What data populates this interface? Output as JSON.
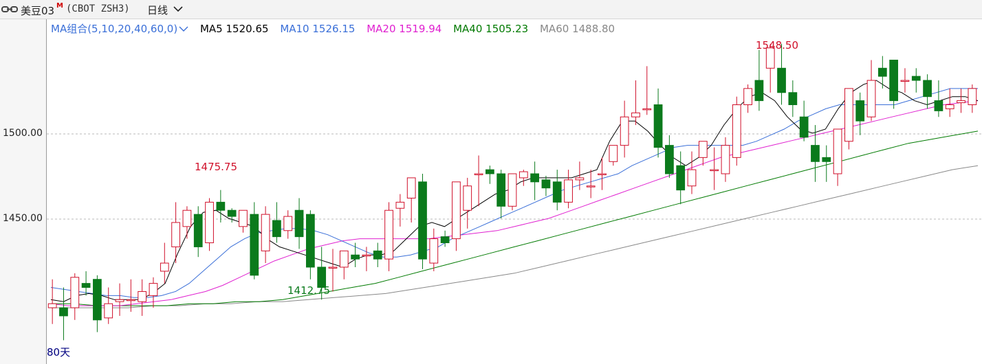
{
  "title": {
    "name": "美豆03",
    "superscript": "M",
    "code": "(CBOT ZSH3)",
    "period": "日线"
  },
  "ma_legend": {
    "selector": "MA组合(5,10,20,40,60,0)",
    "items": [
      {
        "label": "MA5",
        "value": "1520.65",
        "color": "#000000"
      },
      {
        "label": "MA10",
        "value": "1526.15",
        "color": "#3a6fd8"
      },
      {
        "label": "MA20",
        "value": "1519.94",
        "color": "#e020d0"
      },
      {
        "label": "MA40",
        "value": "1505.23",
        "color": "#007a00"
      },
      {
        "label": "MA60",
        "value": "1488.80",
        "color": "#888888"
      }
    ]
  },
  "y_axis": {
    "ticks": [
      {
        "value": 1500,
        "label": "1500.00"
      },
      {
        "value": 1450,
        "label": "1450.00"
      }
    ]
  },
  "annotations": {
    "high_label": "1548.50",
    "high_value": 1548.5,
    "low_label": "1412.75",
    "low_value": 1412.75,
    "peak_label": "1475.75",
    "peak_value": 1475.75
  },
  "days_label": "80天",
  "colors": {
    "up": "#d0102a",
    "down": "#0b7a1c",
    "ma5": "#000000",
    "ma10": "#3a6fd8",
    "ma20": "#e020d0",
    "ma40": "#007a00",
    "ma60": "#888888"
  },
  "chart_data": {
    "type": "candlestick",
    "y_range": [
      1393,
      1552
    ],
    "candles": [
      [
        1418,
        1432,
        1420,
        1410
      ],
      [
        1418,
        1428,
        1414,
        1402
      ],
      [
        1418,
        1435,
        1433,
        1412
      ],
      [
        1430,
        1436,
        1428,
        1424
      ],
      [
        1432,
        1434,
        1412,
        1406
      ],
      [
        1413,
        1428,
        1420,
        1410
      ],
      [
        1421,
        1430,
        1422,
        1414
      ],
      [
        1422,
        1432,
        1422,
        1416
      ],
      [
        1421,
        1432,
        1426,
        1414
      ],
      [
        1424,
        1433,
        1430,
        1418
      ],
      [
        1436,
        1450,
        1440,
        1430
      ],
      [
        1448,
        1470,
        1460,
        1440
      ],
      [
        1458,
        1468,
        1466,
        1452
      ],
      [
        1464,
        1468,
        1448,
        1443
      ],
      [
        1450,
        1472,
        1470,
        1446
      ],
      [
        1470,
        1476,
        1466,
        1460
      ],
      [
        1466,
        1467,
        1463,
        1460
      ],
      [
        1458,
        1466,
        1466,
        1455
      ],
      [
        1464,
        1470,
        1434,
        1432
      ],
      [
        1446,
        1468,
        1464,
        1440
      ],
      [
        1461,
        1470,
        1453,
        1450
      ],
      [
        1456,
        1466,
        1463,
        1452
      ],
      [
        1466,
        1472,
        1453,
        1447
      ],
      [
        1464,
        1466,
        1438,
        1432
      ],
      [
        1438,
        1448,
        1428,
        1422
      ],
      [
        1438,
        1447,
        1438,
        1426
      ],
      [
        1438,
        1445,
        1446,
        1432
      ],
      [
        1444,
        1450,
        1442,
        1438
      ],
      [
        1444,
        1448,
        1444,
        1436
      ],
      [
        1446,
        1450,
        1442,
        1438
      ],
      [
        1442,
        1470,
        1466,
        1436
      ],
      [
        1467,
        1474,
        1470,
        1458
      ],
      [
        1472,
        1482,
        1482,
        1460
      ],
      [
        1480,
        1484,
        1442,
        1437
      ],
      [
        1440,
        1457,
        1452,
        1436
      ],
      [
        1453,
        1456,
        1450,
        1448
      ],
      [
        1452,
        1480,
        1480,
        1446
      ],
      [
        1466,
        1482,
        1478,
        1457
      ],
      [
        1484,
        1493,
        1484,
        1468
      ],
      [
        1486,
        1488,
        1484,
        1479
      ],
      [
        1484,
        1486,
        1468,
        1462
      ],
      [
        1468,
        1484,
        1484,
        1466
      ],
      [
        1482,
        1486,
        1485,
        1478
      ],
      [
        1484,
        1490,
        1480,
        1471
      ],
      [
        1481,
        1483,
        1477,
        1473
      ],
      [
        1480,
        1486,
        1470,
        1466
      ],
      [
        1470,
        1486,
        1481,
        1467
      ],
      [
        1481,
        1490,
        1482,
        1476
      ],
      [
        1478,
        1486,
        1478,
        1472
      ],
      [
        1484,
        1492,
        1484,
        1476
      ],
      [
        1490,
        1494,
        1498,
        1488
      ],
      [
        1498,
        1520,
        1512,
        1492
      ],
      [
        1512,
        1530,
        1514,
        1508
      ],
      [
        1516,
        1537,
        1516,
        1513
      ],
      [
        1518,
        1526,
        1497,
        1492
      ],
      [
        1498,
        1503,
        1484,
        1482
      ],
      [
        1488,
        1495,
        1476,
        1469
      ],
      [
        1478,
        1495,
        1486,
        1474
      ],
      [
        1492,
        1498,
        1500,
        1488
      ],
      [
        1486,
        1497,
        1486,
        1476
      ],
      [
        1484,
        1502,
        1498,
        1480
      ],
      [
        1492,
        1522,
        1518,
        1488
      ],
      [
        1518,
        1528,
        1526,
        1514
      ],
      [
        1530,
        1545,
        1520,
        1515
      ],
      [
        1536,
        1548,
        1546,
        1524
      ],
      [
        1536,
        1548,
        1524,
        1518
      ],
      [
        1524,
        1530,
        1518,
        1512
      ],
      [
        1512,
        1520,
        1502,
        1500
      ],
      [
        1498,
        1508,
        1490,
        1480
      ],
      [
        1492,
        1498,
        1490,
        1480
      ],
      [
        1484,
        1502,
        1506,
        1478
      ],
      [
        1500,
        1522,
        1526,
        1496
      ],
      [
        1520,
        1524,
        1510,
        1503
      ],
      [
        1512,
        1540,
        1530,
        1510
      ],
      [
        1536,
        1542,
        1532,
        1526
      ],
      [
        1540,
        1538,
        1520,
        1516
      ],
      [
        1530,
        1536,
        1530,
        1524
      ],
      [
        1532,
        1536,
        1530,
        1524
      ],
      [
        1530,
        1533,
        1522,
        1516
      ],
      [
        1520,
        1530,
        1515,
        1512
      ],
      [
        1516,
        1526,
        1518,
        1512
      ],
      [
        1519,
        1526,
        1520,
        1514
      ],
      [
        1518,
        1528,
        1526,
        1514
      ]
    ],
    "ma5": [
      1422,
      1421,
      1424,
      1425,
      1424,
      1422,
      1422,
      1422,
      1425,
      1430,
      1445,
      1458,
      1465,
      1466,
      1462,
      1460,
      1458,
      1452,
      1448,
      1446,
      1444,
      1442,
      1440,
      1438,
      1442,
      1444,
      1444,
      1446,
      1452,
      1458,
      1460,
      1458,
      1462,
      1466,
      1470,
      1474,
      1476,
      1480,
      1482,
      1482,
      1482,
      1482,
      1484,
      1486,
      1500,
      1510,
      1510,
      1505,
      1498,
      1492,
      1488,
      1492,
      1498,
      1508,
      1516,
      1522,
      1524,
      1520,
      1512,
      1506,
      1504,
      1506,
      1516,
      1524,
      1528,
      1530,
      1526,
      1524,
      1520,
      1518,
      1520,
      1522,
      1522,
      1520
    ],
    "ma10": [
      1428,
      1427,
      1426,
      1425,
      1424,
      1424,
      1423,
      1423,
      1424,
      1426,
      1430,
      1436,
      1442,
      1448,
      1452,
      1455,
      1456,
      1457,
      1457,
      1456,
      1454,
      1451,
      1448,
      1445,
      1443,
      1443,
      1444,
      1446,
      1448,
      1452,
      1455,
      1458,
      1461,
      1464,
      1467,
      1470,
      1473,
      1476,
      1478,
      1480,
      1482,
      1484,
      1488,
      1491,
      1494,
      1497,
      1498,
      1498,
      1498,
      1498,
      1498,
      1500,
      1503,
      1506,
      1510,
      1513,
      1516,
      1518,
      1518,
      1518,
      1518,
      1518,
      1520,
      1522,
      1524,
      1526,
      1526,
      1526
    ],
    "ma20": [
      1420,
      1419,
      1419,
      1419,
      1419,
      1420,
      1421,
      1422,
      1424,
      1426,
      1429,
      1433,
      1437,
      1441,
      1444,
      1447,
      1449,
      1451,
      1452,
      1452,
      1452,
      1452,
      1452,
      1453,
      1454,
      1455,
      1456,
      1458,
      1460,
      1462,
      1465,
      1468,
      1471,
      1474,
      1477,
      1480,
      1483,
      1486,
      1489,
      1492,
      1494,
      1496,
      1498,
      1500,
      1502,
      1504,
      1506,
      1508,
      1510,
      1512,
      1514,
      1516,
      1518,
      1519,
      1520
    ],
    "ma40": [
      1420,
      1420,
      1419,
      1419,
      1419,
      1419,
      1420,
      1420,
      1421,
      1421,
      1422,
      1424,
      1426,
      1428,
      1430,
      1433,
      1436,
      1439,
      1442,
      1445,
      1448,
      1451,
      1454,
      1457,
      1460,
      1463,
      1466,
      1469,
      1472,
      1475,
      1478,
      1481,
      1484,
      1487,
      1490,
      1493,
      1496,
      1499,
      1501,
      1503,
      1505
    ],
    "ma60": [
      1418,
      1418,
      1418,
      1418,
      1419,
      1419,
      1420,
      1420,
      1421,
      1421,
      1422,
      1423,
      1424,
      1425,
      1427,
      1429,
      1431,
      1433,
      1435,
      1438,
      1441,
      1444,
      1447,
      1450,
      1453,
      1456,
      1459,
      1462,
      1465,
      1468,
      1471,
      1474,
      1477,
      1480,
      1483,
      1486,
      1488
    ]
  }
}
